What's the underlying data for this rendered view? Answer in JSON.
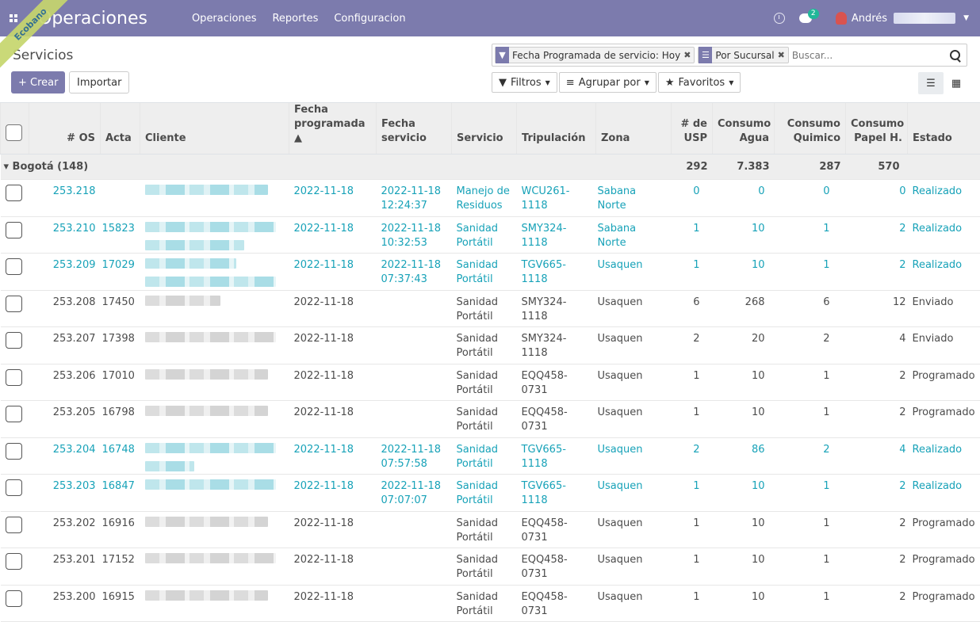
{
  "navbar": {
    "app_title": "Operaciones",
    "menu": [
      "Operaciones",
      "Reportes",
      "Configuracion"
    ],
    "chat_count": "2",
    "user_name": "Andrés",
    "ribbon": "Ecobano"
  },
  "control_panel": {
    "breadcrumb": "Servicios",
    "create_label": "+ Crear",
    "import_label": "Importar",
    "facets": [
      {
        "icon": "filter-icon",
        "label": "Fecha Programada de servicio: Hoy"
      },
      {
        "icon": "group-icon",
        "label": "Por Sucursal"
      }
    ],
    "search_placeholder": "Buscar...",
    "filters_label": "Filtros",
    "groupby_label": "Agrupar por",
    "favorites_label": "Favoritos",
    "views": [
      "list-view",
      "kanban-view"
    ]
  },
  "table": {
    "headers": {
      "os": "# OS",
      "acta": "Acta",
      "cliente": "Cliente",
      "fecha_prog_1": "Fecha",
      "fecha_prog_2": "programada ▲",
      "fecha_serv_1": "Fecha",
      "fecha_serv_2": "servicio",
      "servicio": "Servicio",
      "tripulacion": "Tripulación",
      "zona": "Zona",
      "usp_1": "# de",
      "usp_2": "USP",
      "agua_1": "Consumo",
      "agua_2": "Agua",
      "quimico_1": "Consumo",
      "quimico_2": "Quimico",
      "papel_1": "Consumo",
      "papel_2": "Papel H.",
      "estado": "Estado"
    },
    "group": {
      "label": "▾ Bogotá (148)",
      "usp": "292",
      "agua": "7.383",
      "quimico": "287",
      "papel": "570"
    },
    "rows": [
      {
        "os": "253.218",
        "acta": "",
        "fecha_prog": "2022-11-18",
        "fecha_serv_1": "2022-11-18",
        "fecha_serv_2": "12:24:37",
        "serv_1": "Manejo de",
        "serv_2": "Residuos",
        "trip": "WCU261-1118",
        "zona": "Sabana Norte",
        "usp": "0",
        "agua": "0",
        "quimico": "0",
        "papel": "0",
        "estado": "Realizado",
        "done": true
      },
      {
        "os": "253.210",
        "acta": "15823",
        "fecha_prog": "2022-11-18",
        "fecha_serv_1": "2022-11-18",
        "fecha_serv_2": "10:32:53",
        "serv_1": "Sanidad",
        "serv_2": "Portátil",
        "trip": "SMY324-1118",
        "zona": "Sabana Norte",
        "usp": "1",
        "agua": "10",
        "quimico": "1",
        "papel": "2",
        "estado": "Realizado",
        "done": true
      },
      {
        "os": "253.209",
        "acta": "17029",
        "fecha_prog": "2022-11-18",
        "fecha_serv_1": "2022-11-18",
        "fecha_serv_2": "07:37:43",
        "serv_1": "Sanidad",
        "serv_2": "Portátil",
        "trip": "TGV665-1118",
        "zona": "Usaquen",
        "usp": "1",
        "agua": "10",
        "quimico": "1",
        "papel": "2",
        "estado": "Realizado",
        "done": true
      },
      {
        "os": "253.208",
        "acta": "17450",
        "fecha_prog": "2022-11-18",
        "fecha_serv_1": "",
        "fecha_serv_2": "",
        "serv_1": "Sanidad",
        "serv_2": "Portátil",
        "trip": "SMY324-1118",
        "zona": "Usaquen",
        "usp": "6",
        "agua": "268",
        "quimico": "6",
        "papel": "12",
        "estado": "Enviado",
        "done": false
      },
      {
        "os": "253.207",
        "acta": "17398",
        "fecha_prog": "2022-11-18",
        "fecha_serv_1": "",
        "fecha_serv_2": "",
        "serv_1": "Sanidad",
        "serv_2": "Portátil",
        "trip": "SMY324-1118",
        "zona": "Usaquen",
        "usp": "2",
        "agua": "20",
        "quimico": "2",
        "papel": "4",
        "estado": "Enviado",
        "done": false
      },
      {
        "os": "253.206",
        "acta": "17010",
        "fecha_prog": "2022-11-18",
        "fecha_serv_1": "",
        "fecha_serv_2": "",
        "serv_1": "Sanidad",
        "serv_2": "Portátil",
        "trip": "EQQ458-0731",
        "zona": "Usaquen",
        "usp": "1",
        "agua": "10",
        "quimico": "1",
        "papel": "2",
        "estado": "Programado",
        "done": false
      },
      {
        "os": "253.205",
        "acta": "16798",
        "fecha_prog": "2022-11-18",
        "fecha_serv_1": "",
        "fecha_serv_2": "",
        "serv_1": "Sanidad",
        "serv_2": "Portátil",
        "trip": "EQQ458-0731",
        "zona": "Usaquen",
        "usp": "1",
        "agua": "10",
        "quimico": "1",
        "papel": "2",
        "estado": "Programado",
        "done": false
      },
      {
        "os": "253.204",
        "acta": "16748",
        "fecha_prog": "2022-11-18",
        "fecha_serv_1": "2022-11-18",
        "fecha_serv_2": "07:57:58",
        "serv_1": "Sanidad",
        "serv_2": "Portátil",
        "trip": "TGV665-1118",
        "zona": "Usaquen",
        "usp": "2",
        "agua": "86",
        "quimico": "2",
        "papel": "4",
        "estado": "Realizado",
        "done": true
      },
      {
        "os": "253.203",
        "acta": "16847",
        "fecha_prog": "2022-11-18",
        "fecha_serv_1": "2022-11-18",
        "fecha_serv_2": "07:07:07",
        "serv_1": "Sanidad",
        "serv_2": "Portátil",
        "trip": "TGV665-1118",
        "zona": "Usaquen",
        "usp": "1",
        "agua": "10",
        "quimico": "1",
        "papel": "2",
        "estado": "Realizado",
        "done": true
      },
      {
        "os": "253.202",
        "acta": "16916",
        "fecha_prog": "2022-11-18",
        "fecha_serv_1": "",
        "fecha_serv_2": "",
        "serv_1": "Sanidad",
        "serv_2": "Portátil",
        "trip": "EQQ458-0731",
        "zona": "Usaquen",
        "usp": "1",
        "agua": "10",
        "quimico": "1",
        "papel": "2",
        "estado": "Programado",
        "done": false
      },
      {
        "os": "253.201",
        "acta": "17152",
        "fecha_prog": "2022-11-18",
        "fecha_serv_1": "",
        "fecha_serv_2": "",
        "serv_1": "Sanidad",
        "serv_2": "Portátil",
        "trip": "EQQ458-0731",
        "zona": "Usaquen",
        "usp": "1",
        "agua": "10",
        "quimico": "1",
        "papel": "2",
        "estado": "Programado",
        "done": false
      },
      {
        "os": "253.200",
        "acta": "16915",
        "fecha_prog": "2022-11-18",
        "fecha_serv_1": "",
        "fecha_serv_2": "",
        "serv_1": "Sanidad",
        "serv_2": "Portátil",
        "trip": "EQQ458-0731",
        "zona": "Usaquen",
        "usp": "1",
        "agua": "10",
        "quimico": "1",
        "papel": "2",
        "estado": "Programado",
        "done": false
      }
    ]
  }
}
